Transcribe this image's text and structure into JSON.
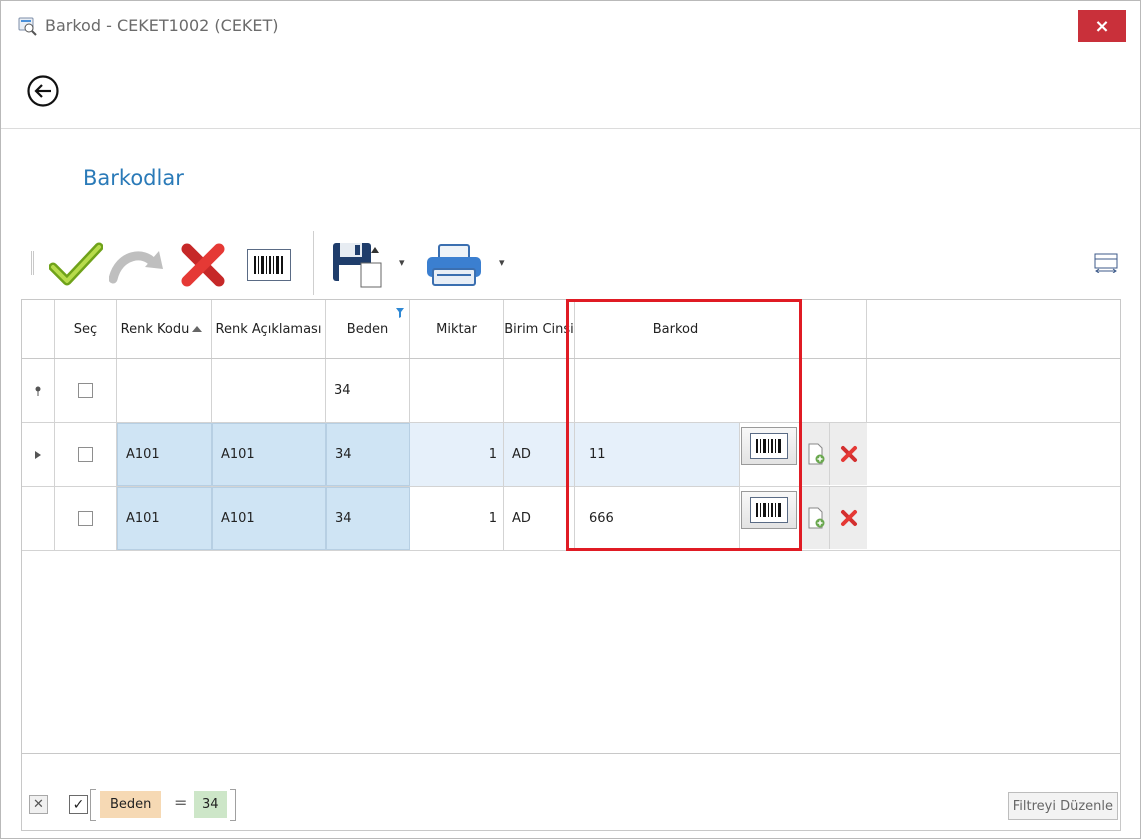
{
  "window": {
    "title": "Barkod - CEKET1002 (CEKET)",
    "close_label": "×"
  },
  "page": {
    "section_title": "Barkodlar"
  },
  "toolbar": {
    "icons": [
      "approve-icon",
      "redo-icon",
      "delete-icon",
      "barcode-icon",
      "save-icon",
      "print-icon",
      "fit-columns-icon"
    ]
  },
  "grid": {
    "columns": [
      "Seç",
      "Renk Kodu",
      "Renk Açıklaması",
      "Beden",
      "Miktar",
      "Birim Cinsi",
      "Barkod"
    ],
    "filter_row": {
      "beden": "34"
    },
    "rows": [
      {
        "renk_kodu": "A101",
        "renk_aciklamasi": "A101",
        "beden": "34",
        "miktar": "1",
        "birim": "AD",
        "barkod": "11"
      },
      {
        "renk_kodu": "A101",
        "renk_aciklamasi": "A101",
        "beden": "34",
        "miktar": "1",
        "birim": "AD",
        "barkod": "666"
      }
    ]
  },
  "footer": {
    "filter_field": "Beden",
    "filter_operator": "=",
    "filter_value": "34",
    "edit_filter_label": "Filtreyi Düzenle"
  },
  "colors": {
    "accent": "#2a7ab8",
    "close": "#c9303a",
    "highlight": "#e01b24",
    "selected_cell": "#cfe4f4"
  }
}
